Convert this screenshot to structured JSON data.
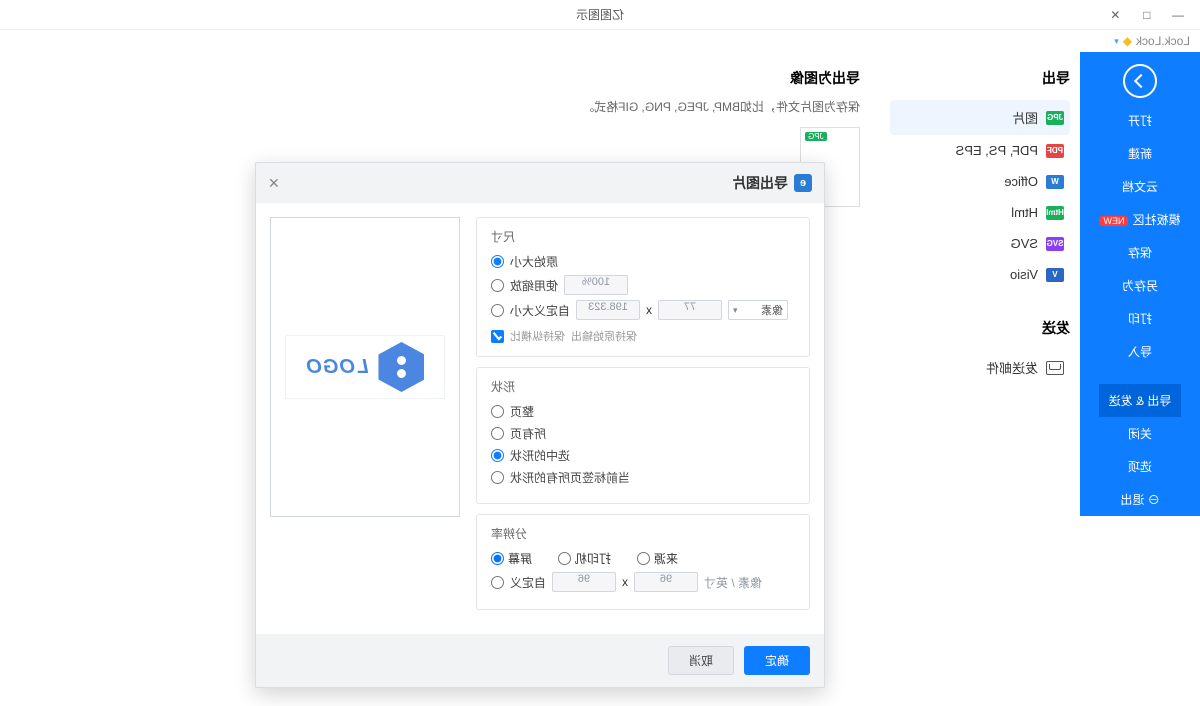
{
  "window": {
    "title": "亿图图示"
  },
  "user": {
    "name": "Lock.Lock"
  },
  "sidebar": {
    "items": [
      {
        "label": "打开"
      },
      {
        "label": "新建"
      },
      {
        "label": "云文档"
      },
      {
        "label": "模板社区",
        "badge": "NEW"
      },
      {
        "label": "保存"
      },
      {
        "label": "另存为"
      },
      {
        "label": "打印"
      },
      {
        "label": "导入"
      },
      {
        "label": "导出 & 发送",
        "active": true
      },
      {
        "label": "关闭"
      },
      {
        "label": "选项"
      },
      {
        "label": "退出",
        "exit": true
      }
    ]
  },
  "formats": {
    "export_heading": "导出",
    "items": [
      {
        "icon": "JPG",
        "cls": "fmt-jpg",
        "label": "图片",
        "selected": true
      },
      {
        "icon": "PDF",
        "cls": "fmt-pdf",
        "label": "PDF, PS, EPS"
      },
      {
        "icon": "W",
        "cls": "fmt-w",
        "label": "Office"
      },
      {
        "icon": "Html",
        "cls": "fmt-html",
        "label": "Html"
      },
      {
        "icon": "SVG",
        "cls": "fmt-svg",
        "label": "SVG"
      },
      {
        "icon": "V",
        "cls": "fmt-v",
        "label": "Visio"
      }
    ],
    "send_heading": "发送",
    "send_label": "发送邮件"
  },
  "pane": {
    "heading": "导出为图像",
    "desc": "保存为图片文件，比如BMP, JPEG, PNG, GIF格式。",
    "thumb_tag": "JPG"
  },
  "modal": {
    "title": "导出图片",
    "size": {
      "heading": "尺寸",
      "original": "原始大小",
      "zoom": "使用缩放",
      "zoom_val": "100%",
      "custom": "自定义大小",
      "w": "198.323",
      "x": "x",
      "h": "77",
      "unit": "像素",
      "keep_ratio": "保持纵横比",
      "keep_original": "保持原始输出"
    },
    "shape": {
      "heading": "形状",
      "full": "整页",
      "all_pages": "所有页",
      "selected": "选中的形状",
      "cur_except": "当前标签页所有的形状"
    },
    "res": {
      "heading": "分辨率",
      "screen": "屏幕",
      "printer": "打印机",
      "source": "来源",
      "custom": "自定义",
      "v1": "96",
      "x": "x",
      "v2": "96",
      "unit": "像素 / 英寸"
    },
    "logo_text": "LOGO",
    "ok": "确定",
    "cancel": "取消"
  }
}
